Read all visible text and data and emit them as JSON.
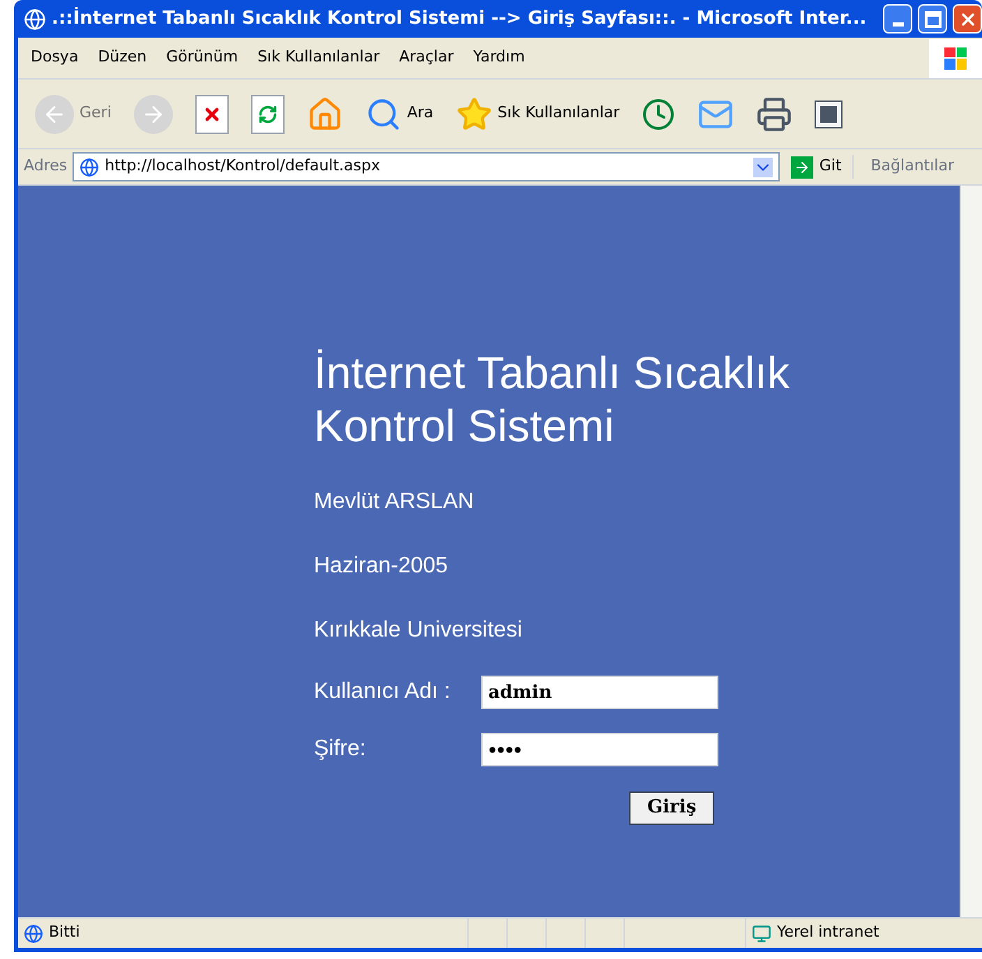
{
  "window": {
    "title": ".::İnternet Tabanlı Sıcaklık Kontrol Sistemi --> Giriş Sayfası::. - Microsoft Inter..."
  },
  "menu": [
    "Dosya",
    "Düzen",
    "Görünüm",
    "Sık Kullanılanlar",
    "Araçlar",
    "Yardım"
  ],
  "toolbar": [
    {
      "kind": "back",
      "label": "Geri",
      "disabled": true
    },
    {
      "kind": "forward",
      "disabled": true
    },
    {
      "kind": "stop",
      "disabled": false
    },
    {
      "kind": "refresh",
      "disabled": false
    },
    {
      "kind": "home",
      "disabled": false
    },
    {
      "kind": "search",
      "label": "Ara",
      "disabled": false
    },
    {
      "kind": "favorites",
      "label": "Sık Kullanılanlar",
      "disabled": false
    },
    {
      "kind": "history",
      "disabled": false
    },
    {
      "kind": "mail",
      "disabled": false
    },
    {
      "kind": "print",
      "disabled": false
    },
    {
      "kind": "word",
      "disabled": false
    }
  ],
  "address": {
    "label": "Adres",
    "url": "http://localhost/Kontrol/default.aspx",
    "go": "Git",
    "links": "Bağlantılar"
  },
  "page": {
    "heading": "İnternet Tabanlı Sıcaklık Kontrol Sistemi",
    "author": "Mevlüt ARSLAN",
    "date": "Haziran-2005",
    "university": "Kırıkkale Universitesi",
    "username": {
      "label": "Kullanıcı Adı :",
      "value": "admin"
    },
    "password": {
      "label": "Şifre:",
      "value": "●●●●"
    },
    "submit": "Giriş"
  },
  "status_bar": {
    "text": "Bitti",
    "zone": "Yerel intranet"
  }
}
